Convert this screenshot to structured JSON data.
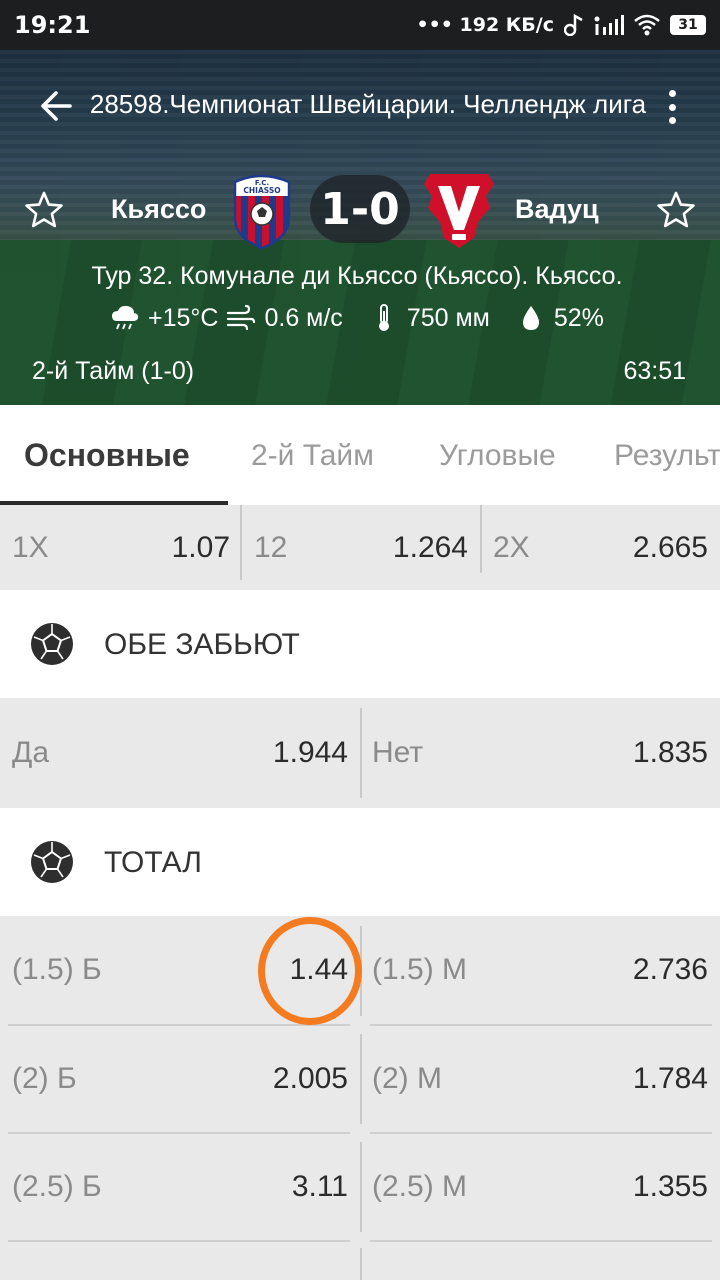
{
  "status_bar": {
    "time": "19:21",
    "network_speed": "••• 192 КБ/с",
    "battery": "31",
    "icons": [
      "music-icon",
      "signal-icon",
      "wifi-icon",
      "battery-icon"
    ]
  },
  "header": {
    "title": "28598.Чемпионат Швейцарии. Челлендж лига",
    "home_team": "Кьяссо",
    "away_team": "Вадуц",
    "score": "1-0",
    "venue": "Тур 32. Комунале ди Кьяссо (Кьяссо). Кьяссо.",
    "weather": {
      "temperature": "+15°C",
      "wind": "0.6 м/с",
      "pressure": "750 мм",
      "humidity": "52%"
    },
    "half_info": "2-й  Тайм (1-0)",
    "match_time": "63:51",
    "home_logo_text": "F.C. CHIASSO",
    "away_logo_text": "V"
  },
  "tabs": [
    "Основные",
    "2-й  Тайм",
    "Угловые",
    "Результ"
  ],
  "double_chance": [
    {
      "label": "1X",
      "value": "1.07"
    },
    {
      "label": "12",
      "value": "1.264"
    },
    {
      "label": "2X",
      "value": "2.665"
    }
  ],
  "both_score": {
    "title": "ОБЕ ЗАБЬЮТ",
    "items": [
      {
        "label": "Да",
        "value": "1.944"
      },
      {
        "label": "Нет",
        "value": "1.835"
      }
    ]
  },
  "total": {
    "title": "ТОТАЛ",
    "rows": [
      [
        {
          "label": "(1.5) Б",
          "value": "1.44"
        },
        {
          "label": "(1.5) М",
          "value": "2.736"
        }
      ],
      [
        {
          "label": "(2) Б",
          "value": "2.005"
        },
        {
          "label": "(2) М",
          "value": "1.784"
        }
      ],
      [
        {
          "label": "(2.5) Б",
          "value": "3.11"
        },
        {
          "label": "(2.5) М",
          "value": "1.355"
        }
      ]
    ]
  },
  "colors": {
    "highlight": "#f47b20",
    "home_team_red": "#c8102e",
    "home_team_blue": "#1f3a8a",
    "away_team_red": "#d0102a"
  }
}
